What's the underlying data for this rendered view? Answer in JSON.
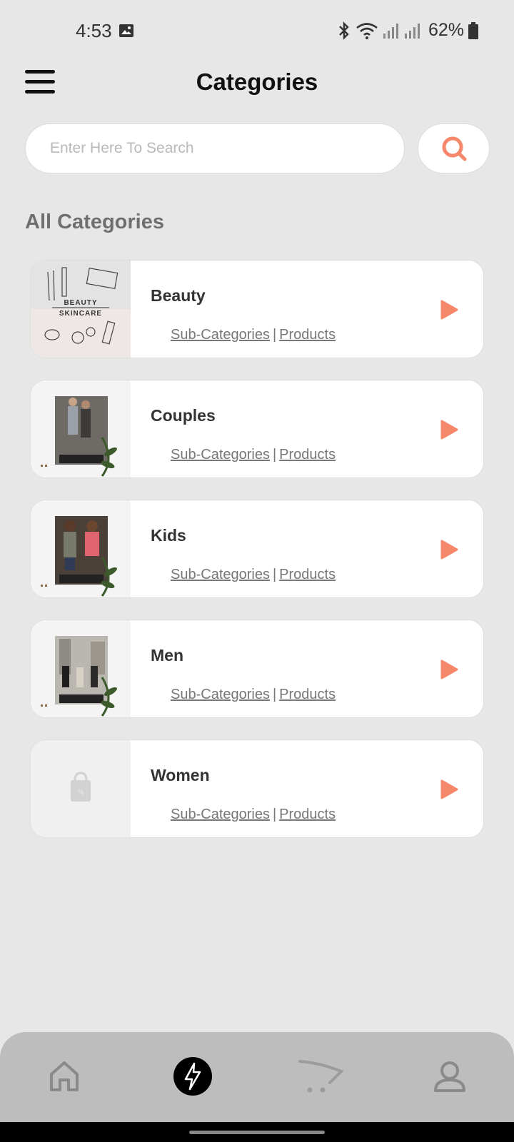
{
  "status_bar": {
    "time": "4:53",
    "battery": "62%"
  },
  "header": {
    "title": "Categories"
  },
  "search": {
    "placeholder": "Enter Here To Search"
  },
  "section": {
    "title": "All Categories"
  },
  "categories": [
    {
      "name": "Beauty",
      "thumb_text_1": "BEAUTY",
      "thumb_text_2": "SKINCARE"
    },
    {
      "name": "Couples"
    },
    {
      "name": "Kids"
    },
    {
      "name": "Men"
    },
    {
      "name": "Women"
    }
  ],
  "links": {
    "sub_categories": "Sub-Categories",
    "products": "Products",
    "separator": "|"
  },
  "bottom_nav": [
    "home-icon",
    "flash-icon",
    "cart-icon",
    "profile-icon"
  ],
  "colors": {
    "accent": "#f5876a",
    "background": "#e7e7e7",
    "nav": "#bdbdbd"
  }
}
